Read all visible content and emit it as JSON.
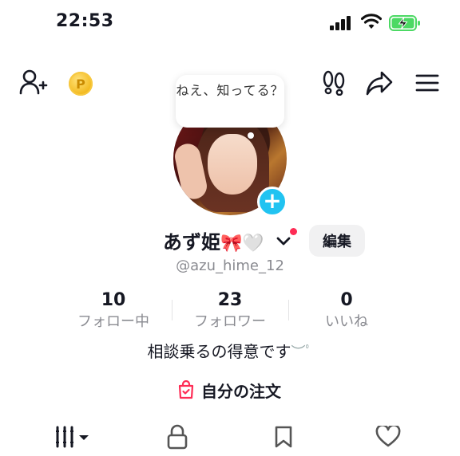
{
  "status_bar": {
    "time": "22:53"
  },
  "profile": {
    "tooltip": "ねえ、知ってる？",
    "display_name": "あず姫",
    "display_emojis": "🎀🤍",
    "handle": "@azu_hime_12",
    "edit_label": "編集",
    "stats": [
      {
        "value": "10",
        "label": "フォロー中"
      },
      {
        "value": "23",
        "label": "フォロワー"
      },
      {
        "value": "0",
        "label": "いいね"
      }
    ],
    "bio": "相談乗るの得意です",
    "bio_emojis": "︶ﾟ",
    "orders_label": "自分の注文"
  },
  "coin_symbol": "P",
  "colors": {
    "accent_blue": "#21c3f1",
    "accent_red": "#fe2c55",
    "battery_green": "#4cd964"
  }
}
